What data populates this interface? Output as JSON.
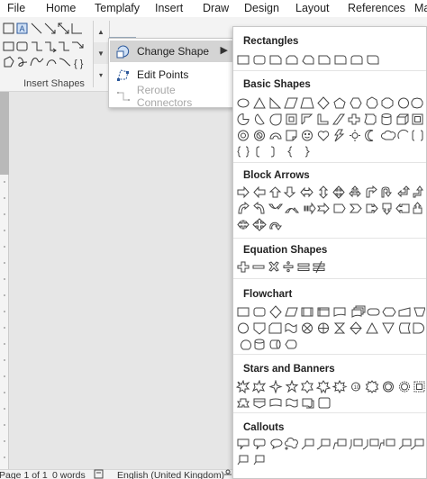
{
  "tabs": [
    "File",
    "Home",
    "Templafy",
    "Insert",
    "Draw",
    "Design",
    "Layout",
    "References",
    "Ma"
  ],
  "ribbon": {
    "group_label": "Insert Shapes"
  },
  "edit_shape_menu": {
    "items": [
      {
        "label": "Change Shape",
        "icon": "change-shape-icon",
        "state": "highlighted",
        "has_submenu": true
      },
      {
        "label": "Edit Points",
        "icon": "edit-points-icon",
        "state": "enabled"
      },
      {
        "label": "Reroute Connectors",
        "icon": "reroute-connectors-icon",
        "state": "disabled"
      }
    ]
  },
  "shape_gallery": {
    "categories": [
      {
        "title": "Rectangles",
        "rows": [
          [
            "rect",
            "rounded-rect",
            "snip-single",
            "snip-same",
            "snip-diag",
            "snip-round",
            "round-single",
            "round-same",
            "round-diag"
          ]
        ]
      },
      {
        "title": "Basic Shapes",
        "rows": [
          [
            "oval",
            "triangle",
            "right-triangle",
            "parallelogram",
            "trapezoid",
            "diamond",
            "pentagon",
            "hexagon",
            "heptagon",
            "octagon",
            "decagon",
            "dodecagon"
          ],
          [
            "pie",
            "chord",
            "teardrop",
            "frame",
            "half-frame",
            "l-shape",
            "diag-stripe",
            "cross",
            "plaque",
            "can",
            "cube",
            "bevel"
          ],
          [
            "donut",
            "no-symbol",
            "block-arc",
            "folded-corner",
            "smiley",
            "heart",
            "lightning",
            "sun",
            "moon",
            "cloud",
            "arc",
            "double-bracket"
          ],
          [
            "double-brace",
            "left-bracket",
            "right-bracket",
            "left-brace",
            "right-brace"
          ]
        ]
      },
      {
        "title": "Block Arrows",
        "rows": [
          [
            "right-arrow",
            "left-arrow",
            "up-arrow",
            "down-arrow",
            "left-right-arrow",
            "up-down-arrow",
            "quad-arrow",
            "left-right-up-arrow",
            "bent-arrow",
            "u-turn-arrow",
            "left-up-arrow",
            "bent-up-arrow"
          ],
          [
            "curved-right-arrow",
            "curved-left-arrow",
            "curved-up-arrow",
            "curved-down-arrow",
            "striped-right-arrow",
            "notched-right-arrow",
            "pentagon-arrow",
            "chevron",
            "right-callout-arrow",
            "down-callout-arrow",
            "left-callout-arrow",
            "up-callout-arrow"
          ],
          [
            "left-right-callout",
            "quad-callout",
            "circular-arrow"
          ]
        ]
      },
      {
        "title": "Equation Shapes",
        "rows": [
          [
            "plus",
            "minus",
            "multiply",
            "division",
            "equal",
            "not-equal"
          ]
        ]
      },
      {
        "title": "Flowchart",
        "rows": [
          [
            "process",
            "alternate-process",
            "decision",
            "data",
            "predefined-process",
            "internal-storage",
            "document",
            "multidocument",
            "terminator",
            "preparation",
            "manual-input",
            "manual-operation"
          ],
          [
            "connector",
            "off-page-connector",
            "card",
            "punched-tape",
            "summing-junction",
            "or",
            "collate",
            "sort",
            "extract",
            "merge",
            "stored-data",
            "delay"
          ],
          [
            "sequential-access",
            "magnetic-disk",
            "direct-access",
            "display"
          ]
        ]
      },
      {
        "title": "Stars and Banners",
        "rows": [
          [
            "explosion-1",
            "explosion-2",
            "star-4",
            "star-5",
            "star-6",
            "star-7",
            "star-8",
            "star-10",
            "star-12",
            "star-16",
            "star-24",
            "star-32"
          ]
        ]
      },
      {
        "title": "Callouts",
        "rows": [
          [
            "rect-callout",
            "rounded-callout",
            "oval-callout",
            "cloud-callout",
            "line-callout-1",
            "line-callout-2",
            "line-callout-3",
            "line-callout-4",
            "line-callout-5",
            "line-callout-6",
            "line-callout-7",
            "line-callout-8"
          ]
        ]
      }
    ]
  },
  "status_bar": {
    "page": "Page 1 of 1",
    "words": "0 words",
    "language": "English (United Kingdom)"
  }
}
